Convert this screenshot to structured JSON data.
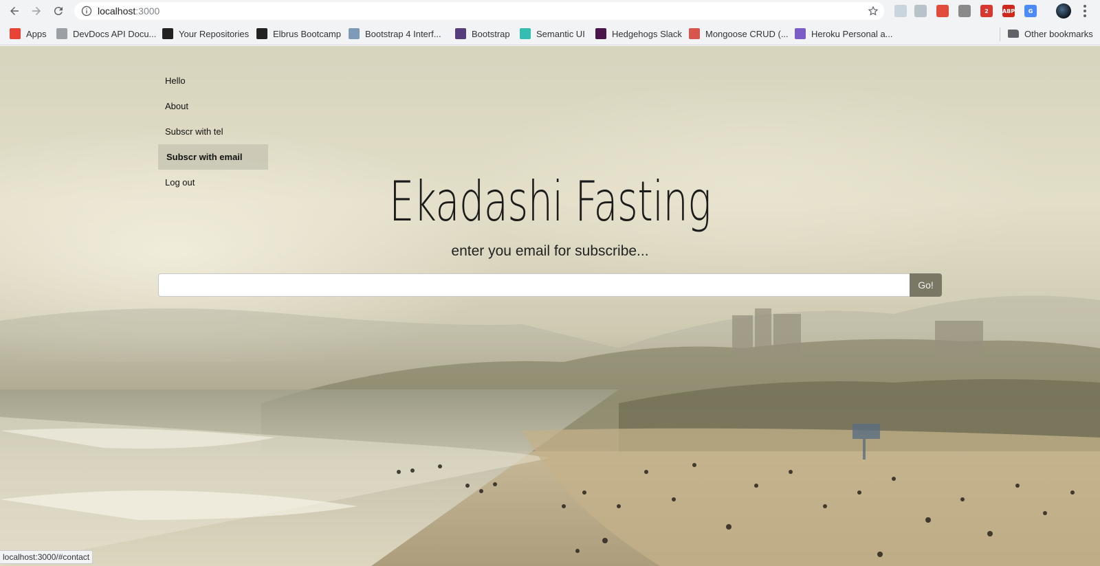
{
  "browser": {
    "url_host": "localhost",
    "url_port": ":3000",
    "extensions": [
      {
        "name": "react-devtools-icon",
        "text": "",
        "color": "#c9d4dc"
      },
      {
        "name": "sparkle-icon",
        "text": "",
        "color": "#b7c2c9"
      },
      {
        "name": "puzzle-icon",
        "text": "",
        "color": "#e34b3b"
      },
      {
        "name": "sync-icon",
        "text": "",
        "color": "#8a8a8a"
      },
      {
        "name": "todo-extension-icon",
        "text": "2",
        "color": "#d8382e"
      },
      {
        "name": "adblock-icon",
        "text": "ABP",
        "color": "#d1261c"
      },
      {
        "name": "translate-icon",
        "text": "G",
        "color": "#4c8bf5"
      }
    ]
  },
  "bookmarks": [
    {
      "label": "Apps",
      "icon": "apps-grid-icon",
      "color": "#e94335"
    },
    {
      "label": "DevDocs API Docu...",
      "icon": "devdocs-icon",
      "color": "#9aa0a6"
    },
    {
      "label": "Your Repositories",
      "icon": "github-icon",
      "color": "#222222"
    },
    {
      "label": "Elbrus Bootcamp",
      "icon": "github-icon",
      "color": "#222222"
    },
    {
      "label": "Bootstrap 4 Interf...",
      "icon": "cube-icon",
      "color": "#7d9bb8"
    },
    {
      "label": "Bootstrap",
      "icon": "bootstrap-icon",
      "color": "#563d7c"
    },
    {
      "label": "Semantic UI",
      "icon": "semantic-icon",
      "color": "#35bdb2"
    },
    {
      "label": "Hedgehogs Slack",
      "icon": "slack-icon",
      "color": "#4a154b"
    },
    {
      "label": "Mongoose CRUD (...",
      "icon": "mongoose-icon",
      "color": "#d6554d"
    },
    {
      "label": "Heroku Personal a...",
      "icon": "heroku-icon",
      "color": "#7a5dc7"
    }
  ],
  "other_bookmarks": "Other bookmarks",
  "sidenav": [
    {
      "label": "Hello",
      "active": false
    },
    {
      "label": "About",
      "active": false
    },
    {
      "label": "Subscr with tel",
      "active": false
    },
    {
      "label": "Subscr with email",
      "active": true
    },
    {
      "label": "Log out",
      "active": false
    }
  ],
  "hero": {
    "title": "Ekadashi Fasting",
    "subtitle": "enter you email for subscribe...",
    "input_value": "",
    "button_label": "Go!"
  },
  "status_bar": "localhost:3000/#contact",
  "colors": {
    "go_button": "#7a7864",
    "active_nav": "#c8c6b4"
  }
}
